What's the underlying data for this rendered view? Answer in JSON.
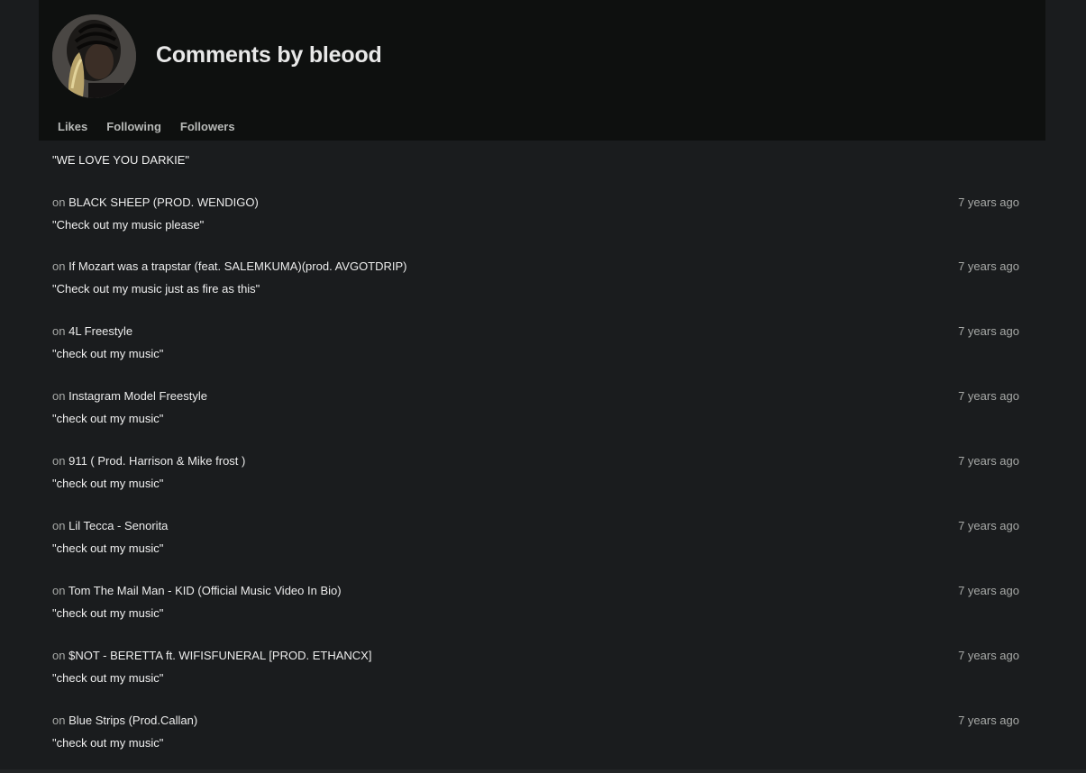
{
  "profile": {
    "title": "Comments by bleood"
  },
  "tabs": [
    {
      "label": "Likes"
    },
    {
      "label": "Following"
    },
    {
      "label": "Followers"
    }
  ],
  "comments": [
    {
      "on": "",
      "track": "",
      "time": "",
      "text": "\"WE LOVE YOU DARKIE\""
    },
    {
      "on": "on",
      "track": "BLACK SHEEP (PROD. WENDIGO)",
      "time": "7 years ago",
      "text": "\"Check out my music please\""
    },
    {
      "on": "on",
      "track": "If Mozart was a trapstar (feat. SALEMKUMA)(prod. AVGOTDRIP)",
      "time": "7 years ago",
      "text": "\"Check out my music just as fire as this\""
    },
    {
      "on": "on",
      "track": "4L Freestyle",
      "time": "7 years ago",
      "text": "\"check out my music\""
    },
    {
      "on": "on",
      "track": "Instagram Model Freestyle",
      "time": "7 years ago",
      "text": "\"check out my music\""
    },
    {
      "on": "on",
      "track": "911 ( Prod. Harrison & Mike frost )",
      "time": "7 years ago",
      "text": "\"check out my music\""
    },
    {
      "on": "on",
      "track": "Lil Tecca - Senorita",
      "time": "7 years ago",
      "text": "\"check out my music\""
    },
    {
      "on": "on",
      "track": "Tom The Mail Man - KID (Official Music Video In Bio)",
      "time": "7 years ago",
      "text": "\"check out my music\""
    },
    {
      "on": "on",
      "track": "$NOT - BERETTA ft. WIFISFUNERAL [PROD. ETHANCX]",
      "time": "7 years ago",
      "text": "\"check out my music\""
    },
    {
      "on": "on",
      "track": "Blue Strips (Prod.Callan)",
      "time": "7 years ago",
      "text": "\"check out my music\""
    }
  ]
}
